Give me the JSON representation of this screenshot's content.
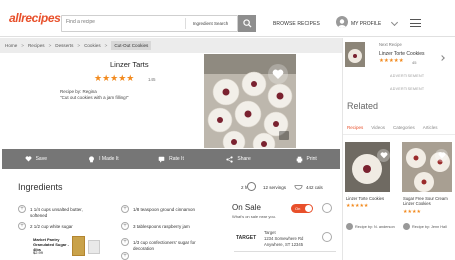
{
  "header": {
    "logo": "allrecipes",
    "search_placeholder": "Find a recipe",
    "ingredient_search_label": "Ingredient Search",
    "browse_label": "BROWSE RECIPES",
    "profile_label": "MY PROFILE"
  },
  "breadcrumb": [
    "Home",
    "Recipes",
    "Desserts",
    "Cookies",
    "Cut-Out Cookies"
  ],
  "recipe": {
    "title": "Linzer Tarts",
    "stars": "★★★★★",
    "rating_count": "145",
    "recipe_by": "Recipe by: Regina",
    "quote": "\"Cut out cookies with a jam filling!\""
  },
  "actions": [
    {
      "icon": "heart-icon",
      "label": "Save"
    },
    {
      "icon": "chef-hat-icon",
      "label": "I Made It"
    },
    {
      "icon": "rate-icon",
      "label": "Rate It"
    },
    {
      "icon": "share-icon",
      "label": "Share"
    },
    {
      "icon": "print-icon",
      "label": "Print"
    }
  ],
  "ingredients": {
    "title": "Ingredients",
    "time": "2 h",
    "servings": "12 servings",
    "calories": "442 cals",
    "items_left": [
      "1 1/4 cups unsalted butter, softened",
      "2 1/2 cup white sugar"
    ],
    "items_right": [
      "1/8 teaspoon ground cinnamon",
      "3 tablespoons raspberry jam",
      "1/3 cup confectioners' sugar for decoration"
    ],
    "ad_brand": "Market Pantry Granulated Sugar - 4lbs",
    "ad_price": "$2.99"
  },
  "onsale": {
    "title": "On Sale",
    "subtitle": "What's on sale near you.",
    "toggle_label": "On",
    "store_logo": "TARGET",
    "store_lines": [
      "Target",
      "1234 Somewhere Rd",
      "Anywhere, ST 12345"
    ]
  },
  "sidebar": {
    "next_label": "Next Recipe",
    "next_title": "Linzer Torte Cookies",
    "next_stars": "★★★★★",
    "next_count": "45",
    "advertisement_1": "ADVERTISEMENT",
    "advertisement_2": "ADVERTISEMENT",
    "related_title": "Related",
    "tabs": [
      "Recipes",
      "Videos",
      "Categories",
      "Articles"
    ],
    "cards": [
      {
        "title": "Linzer Torte Cookies",
        "stars": "★★★★★",
        "by": "Recipe by: N. anderson"
      },
      {
        "title": "Sugar Free Sour Cream Linzer Cookies",
        "stars": "★★★★",
        "by": "Recipe by: Jenn Hall"
      }
    ]
  },
  "colors": {
    "accent": "#e8502b",
    "star": "#f28a1e",
    "action_bar": "#767676"
  }
}
